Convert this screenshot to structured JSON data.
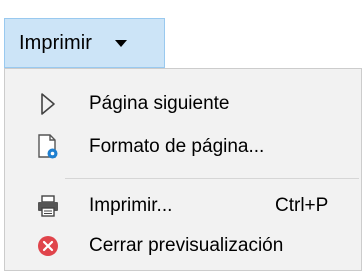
{
  "toolbar": {
    "print_button": {
      "label": "Imprimir",
      "icon": "chevron-down-icon"
    },
    "highlight_color": "#cce4f7"
  },
  "menu": {
    "items": [
      {
        "label": "Página siguiente",
        "icon": "play-triangle-icon",
        "shortcut": ""
      },
      {
        "label": "Formato de página...",
        "icon": "page-settings-icon",
        "shortcut": ""
      },
      {
        "label": "Imprimir...",
        "icon": "printer-icon",
        "shortcut": "Ctrl+P"
      },
      {
        "label": "Cerrar previsualización",
        "icon": "close-circle-icon",
        "shortcut": ""
      }
    ],
    "background": "#f2f2f2"
  }
}
